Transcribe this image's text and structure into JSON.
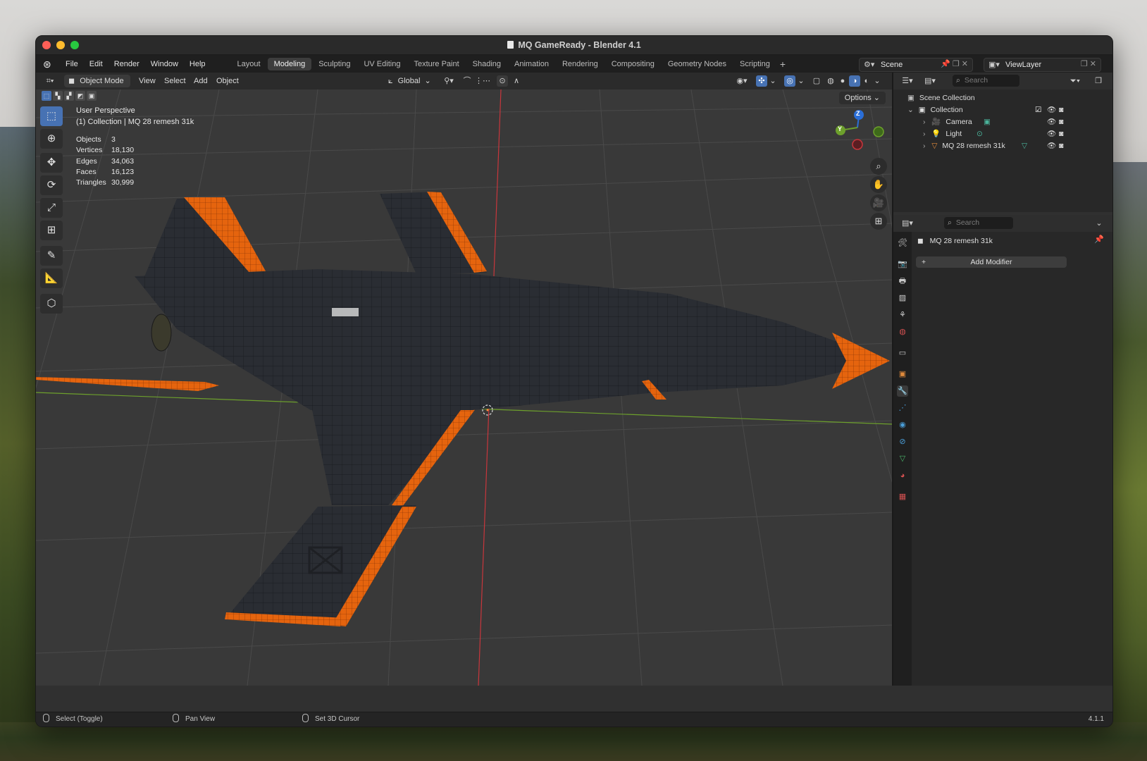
{
  "window": {
    "title": "MQ GameReady - Blender 4.1"
  },
  "menu": [
    "File",
    "Edit",
    "Render",
    "Window",
    "Help"
  ],
  "workspaces": [
    "Layout",
    "Modeling",
    "Sculpting",
    "UV Editing",
    "Texture Paint",
    "Shading",
    "Animation",
    "Rendering",
    "Compositing",
    "Geometry Nodes",
    "Scripting"
  ],
  "active_workspace": "Modeling",
  "scene": {
    "label": "Scene"
  },
  "view_layer": {
    "label": "ViewLayer"
  },
  "viewport_header": {
    "mode": "Object Mode",
    "menus": [
      "View",
      "Select",
      "Add",
      "Object"
    ],
    "orientation": "Global"
  },
  "viewport": {
    "perspective": "User Perspective",
    "collection_line": "(1) Collection | MQ 28 remesh 31k",
    "options": "Options",
    "stats": [
      {
        "label": "Objects",
        "value": "3"
      },
      {
        "label": "Vertices",
        "value": "18,130"
      },
      {
        "label": "Edges",
        "value": "34,063"
      },
      {
        "label": "Faces",
        "value": "16,123"
      },
      {
        "label": "Triangles",
        "value": "30,999"
      }
    ],
    "gizmo": {
      "z": "Z",
      "y": "Y"
    }
  },
  "outliner": {
    "search_placeholder": "Search",
    "scene_collection": "Scene Collection",
    "collection": "Collection",
    "items": [
      "Camera",
      "Light",
      "MQ 28 remesh 31k"
    ]
  },
  "properties": {
    "search_placeholder": "Search",
    "object_name": "MQ 28 remesh 31k",
    "add_modifier": "Add Modifier"
  },
  "statusbar": {
    "select": "Select (Toggle)",
    "pan": "Pan View",
    "cursor": "Set 3D Cursor",
    "version": "4.1.1"
  },
  "colors": {
    "accent_blue": "#4772b3",
    "axis_red": "#c8363c",
    "axis_green": "#6da02c",
    "aircraft_orange": "#e5640e",
    "aircraft_body": "#2a2d33"
  }
}
